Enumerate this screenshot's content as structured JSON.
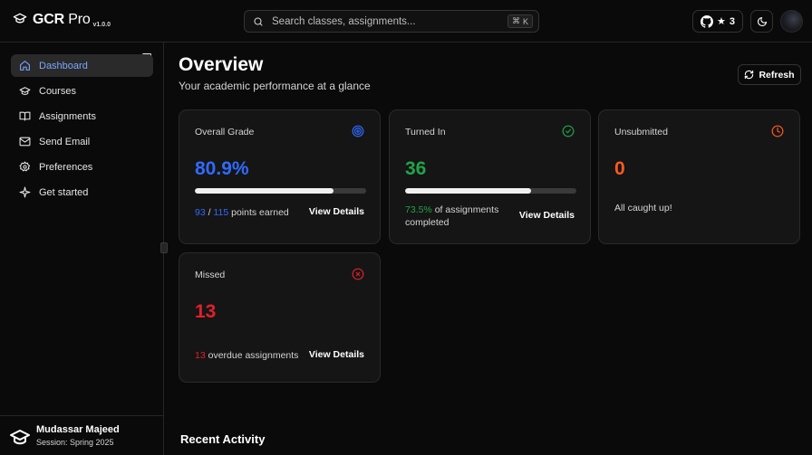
{
  "app": {
    "name": "GCR",
    "name_suffix": "Pro",
    "version": "v1.0.0"
  },
  "search": {
    "placeholder": "Search classes, assignments...",
    "shortcut_symbol": "⌘",
    "shortcut_key": "K"
  },
  "header": {
    "github_stars": "3",
    "star_glyph": "★"
  },
  "sidebar": {
    "items": [
      {
        "label": "Dashboard",
        "icon": "home-icon",
        "active": true
      },
      {
        "label": "Courses",
        "icon": "graduation-cap-icon"
      },
      {
        "label": "Assignments",
        "icon": "book-open-icon"
      },
      {
        "label": "Send Email",
        "icon": "mail-icon"
      },
      {
        "label": "Preferences",
        "icon": "gear-icon"
      },
      {
        "label": "Get started",
        "icon": "sparkle-icon"
      }
    ],
    "user": {
      "name": "Mudassar Majeed",
      "session": "Session: Spring 2025"
    }
  },
  "page": {
    "title": "Overview",
    "subtitle": "Your academic performance at a glance",
    "refresh_label": "Refresh"
  },
  "cards": {
    "grade": {
      "title": "Overall Grade",
      "value": "80.9%",
      "progress": 0.809,
      "earned": "93",
      "sep": " / ",
      "total": "115",
      "suffix": " points earned",
      "link": "View Details",
      "color": "#2f6bff"
    },
    "turned_in": {
      "title": "Turned In",
      "value": "36",
      "progress": 0.735,
      "pct": "73.5%",
      "text_1": " of assignments",
      "text_2": "completed",
      "link": "View Details",
      "color": "#22a34a"
    },
    "unsubmitted": {
      "title": "Unsubmitted",
      "value": "0",
      "message": "All caught up!",
      "color": "#ff5a1f"
    },
    "missed": {
      "title": "Missed",
      "value": "13",
      "count": "13",
      "suffix": " overdue assignments",
      "link": "View Details",
      "color": "#e0202a"
    }
  },
  "recent": {
    "title": "Recent Activity"
  }
}
